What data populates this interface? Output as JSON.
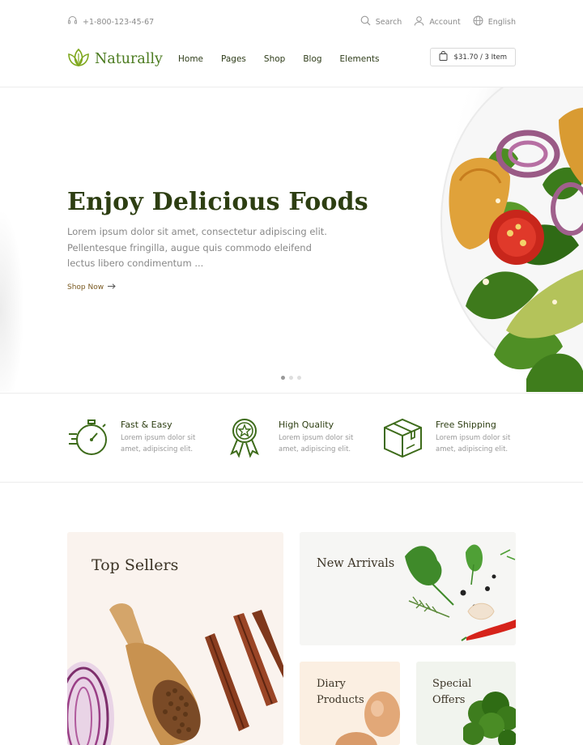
{
  "topbar": {
    "phone": "+1-800-123-45-67",
    "search_label": "Search",
    "account_label": "Account",
    "language_label": "English"
  },
  "header": {
    "logo_text": "Naturally",
    "nav": [
      {
        "label": "Home"
      },
      {
        "label": "Pages"
      },
      {
        "label": "Shop"
      },
      {
        "label": "Blog"
      },
      {
        "label": "Elements"
      }
    ],
    "cart_label": "$31.70 / 3 Item"
  },
  "hero": {
    "title": "Enjoy Delicious Foods",
    "text_lines": [
      "Lorem ipsum dolor sit amet, consectetur adipiscing elit.",
      "Pellentesque fringilla, augue quis commodo eleifend",
      "lectus libero condimentum ..."
    ],
    "cta_label": "Shop Now",
    "slides_total": 3,
    "slide_active": 1
  },
  "features": [
    {
      "title": "Fast & Easy",
      "desc": "Lorem ipsum dolor sit amet, adipiscing elit.",
      "icon": "stopwatch-icon"
    },
    {
      "title": "High Quality",
      "desc": "Lorem ipsum dolor sit amet, adipiscing elit.",
      "icon": "award-badge-icon"
    },
    {
      "title": "Free Shipping",
      "desc": "Lorem ipsum dolor sit amet, adipiscing elit.",
      "icon": "delivery-box-icon"
    }
  ],
  "categories": {
    "top_sellers": "Top Sellers",
    "new_arrivals": "New Arrivals",
    "diary_line1": "Diary",
    "diary_line2": "Products",
    "special_line1": "Special",
    "special_line2": "Offers"
  },
  "colors": {
    "brand_green": "#4a7a1e",
    "dark_green": "#2d3e12",
    "accent_brown": "#7a5a22"
  }
}
